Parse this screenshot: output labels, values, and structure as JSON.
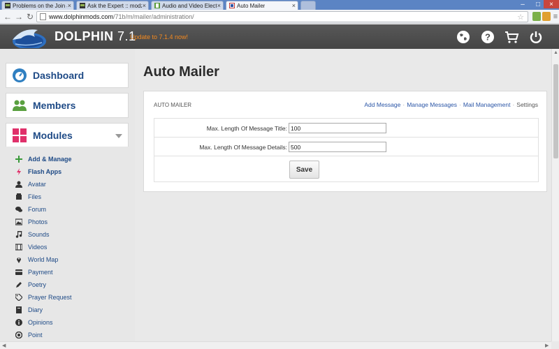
{
  "browser": {
    "tabs": [
      {
        "label": "Problems on the Join and",
        "active": false
      },
      {
        "label": "Ask the Expert :: modzzz",
        "active": false
      },
      {
        "label": "Audio and Video Electron",
        "active": false
      },
      {
        "label": "Auto Mailer",
        "active": true
      }
    ],
    "url_host": "www.dolphinmods.com",
    "url_path": "/71b/m/mailer/administration/"
  },
  "header": {
    "brand": "DOLPHIN",
    "version": "7.1",
    "update_link": "Update to 7.1.4 now!"
  },
  "sidebar": {
    "dashboard": "Dashboard",
    "members": "Members",
    "modules": "Modules",
    "items": [
      {
        "label": "Add & Manage",
        "icon": "plus-icon",
        "bold": true
      },
      {
        "label": "Flash Apps",
        "icon": "flash-icon",
        "bold": true
      },
      {
        "label": "Avatar",
        "icon": "avatar-icon"
      },
      {
        "label": "Files",
        "icon": "files-icon"
      },
      {
        "label": "Forum",
        "icon": "forum-icon"
      },
      {
        "label": "Photos",
        "icon": "photos-icon"
      },
      {
        "label": "Sounds",
        "icon": "sounds-icon"
      },
      {
        "label": "Videos",
        "icon": "videos-icon"
      },
      {
        "label": "World Map",
        "icon": "map-pin-icon"
      },
      {
        "label": "Payment",
        "icon": "payment-icon"
      },
      {
        "label": "Poetry",
        "icon": "pencil-icon"
      },
      {
        "label": "Prayer Request",
        "icon": "tag-icon"
      },
      {
        "label": "Diary",
        "icon": "book-icon"
      },
      {
        "label": "Opinions",
        "icon": "info-icon"
      },
      {
        "label": "Point",
        "icon": "point-icon"
      }
    ]
  },
  "main": {
    "title": "Auto Mailer",
    "panel_title": "AUTO MAILER",
    "links": [
      "Add Message",
      "Manage Messages",
      "Mail Management",
      "Settings"
    ],
    "form": {
      "title_label": "Max. Length Of Message Title:",
      "title_value": "100",
      "details_label": "Max. Length Of Message Details:",
      "details_value": "500",
      "save_label": "Save"
    }
  },
  "colors": {
    "accent_link": "#2a55a6",
    "nav_text": "#1e4a86",
    "update": "#f58a1f",
    "header_bg": "#4f4f4f"
  }
}
